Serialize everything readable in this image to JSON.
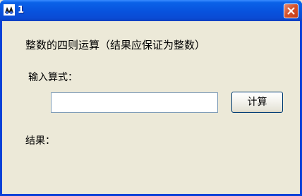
{
  "window": {
    "title": "1",
    "app_icon": "app-icon",
    "close_icon": "close-icon",
    "accent_color": "#0a4bd4",
    "close_color": "#d5532e"
  },
  "main": {
    "heading": "整数的四则运算（结果应保证为整数）",
    "input_label": "输入算式：",
    "expression_value": "",
    "calculate_label": "计算",
    "result_label": "结果："
  }
}
